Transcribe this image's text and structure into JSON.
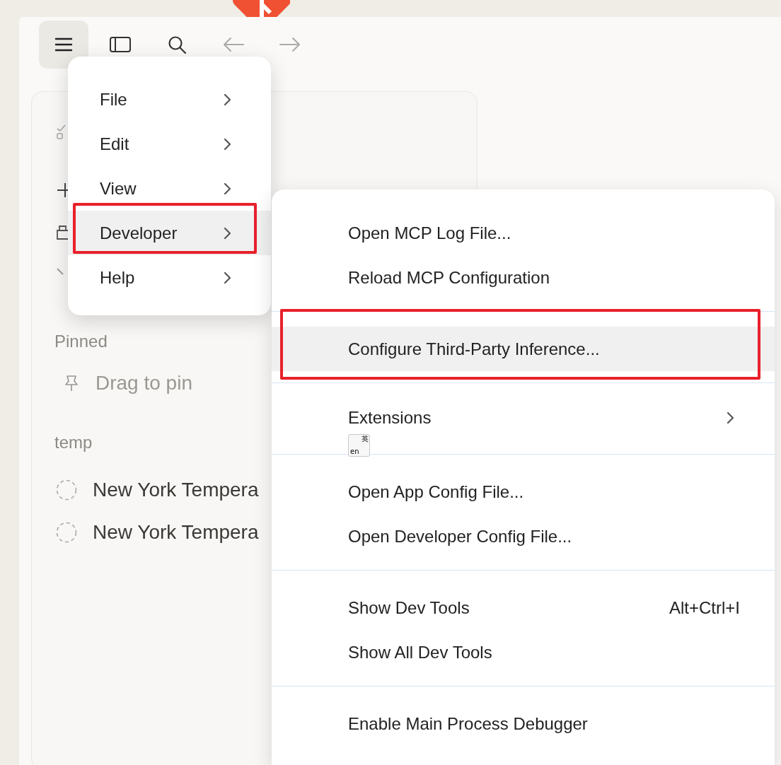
{
  "toolbar": {
    "buttons": [
      {
        "kind": "menu",
        "active": true,
        "disabled": false
      },
      {
        "kind": "sidebar",
        "active": false,
        "disabled": false
      },
      {
        "kind": "search",
        "active": false,
        "disabled": false
      },
      {
        "kind": "back",
        "active": false,
        "disabled": true
      },
      {
        "kind": "forward",
        "active": false,
        "disabled": true
      }
    ]
  },
  "sidebar": {
    "sections": [
      {
        "title": "Pinned",
        "items": [
          {
            "kind": "hint",
            "label": "Drag to pin"
          }
        ]
      },
      {
        "title": "temp",
        "items": [
          {
            "kind": "chat",
            "label": "New York Tempera"
          },
          {
            "kind": "chat",
            "label": "New York Tempera"
          }
        ]
      }
    ]
  },
  "menu": {
    "items": [
      {
        "label": "File",
        "selected": false,
        "outlined": false,
        "has_submenu": true
      },
      {
        "label": "Edit",
        "selected": false,
        "outlined": false,
        "has_submenu": true
      },
      {
        "label": "View",
        "selected": false,
        "outlined": false,
        "has_submenu": true
      },
      {
        "label": "Developer",
        "selected": true,
        "outlined": true,
        "has_submenu": true
      },
      {
        "label": "Help",
        "selected": false,
        "outlined": false,
        "has_submenu": true
      }
    ]
  },
  "submenu": {
    "items": [
      {
        "kind": "item",
        "label": "Open MCP Log File...",
        "selected": false,
        "outlined": false,
        "has_submenu": false
      },
      {
        "kind": "item",
        "label": "Reload MCP Configuration",
        "selected": false,
        "outlined": false,
        "has_submenu": false
      },
      {
        "kind": "separator"
      },
      {
        "kind": "item",
        "label": "Configure Third-Party Inference...",
        "selected": true,
        "outlined": true,
        "has_submenu": false
      },
      {
        "kind": "separator"
      },
      {
        "kind": "item",
        "label": "Extensions",
        "selected": false,
        "outlined": false,
        "has_submenu": true
      },
      {
        "kind": "separator"
      },
      {
        "kind": "item",
        "label": "Open App Config File...",
        "selected": false,
        "outlined": false,
        "has_submenu": false
      },
      {
        "kind": "item",
        "label": "Open Developer Config File...",
        "selected": false,
        "outlined": false,
        "has_submenu": false
      },
      {
        "kind": "separator"
      },
      {
        "kind": "item",
        "label": "Show Dev Tools",
        "shortcut": "Alt+Ctrl+I",
        "selected": false,
        "outlined": false,
        "has_submenu": false
      },
      {
        "kind": "item",
        "label": "Show All Dev Tools",
        "selected": false,
        "outlined": false,
        "has_submenu": false
      },
      {
        "kind": "separator"
      },
      {
        "kind": "item",
        "label": "Enable Main Process Debugger",
        "selected": false,
        "outlined": false,
        "has_submenu": false
      }
    ]
  },
  "ime_indicator": {
    "latin": "en",
    "cjk": "英"
  }
}
